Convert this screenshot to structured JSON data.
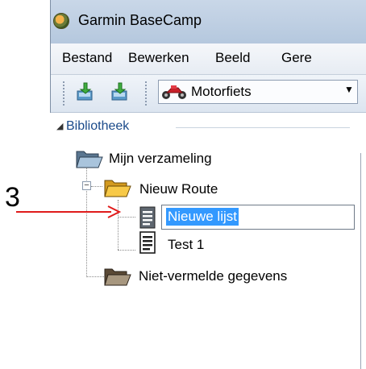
{
  "window": {
    "title": "Garmin BaseCamp",
    "title_icon": "garmin-app-icon"
  },
  "menu": {
    "items": [
      "Bestand",
      "Bewerken",
      "Beeld",
      "Gere"
    ]
  },
  "toolbar": {
    "buttons": [
      "receive-from-device-icon",
      "send-to-device-icon"
    ],
    "activity_profile": {
      "icon": "motorcycle-icon",
      "selected": "Motorfiets"
    }
  },
  "tree": {
    "root": "Bibliotheek",
    "collection": "Mijn verzameling",
    "route": "Nieuw Route",
    "editing_item": "Nieuwe lijst",
    "child_item": "Test 1",
    "unlisted": "Niet-vermelde gegevens"
  },
  "annotation": {
    "number": "3",
    "arrow_color": "#e01b1b"
  },
  "colors": {
    "selection": "#3399ff",
    "library_label": "#1a4a8a"
  }
}
